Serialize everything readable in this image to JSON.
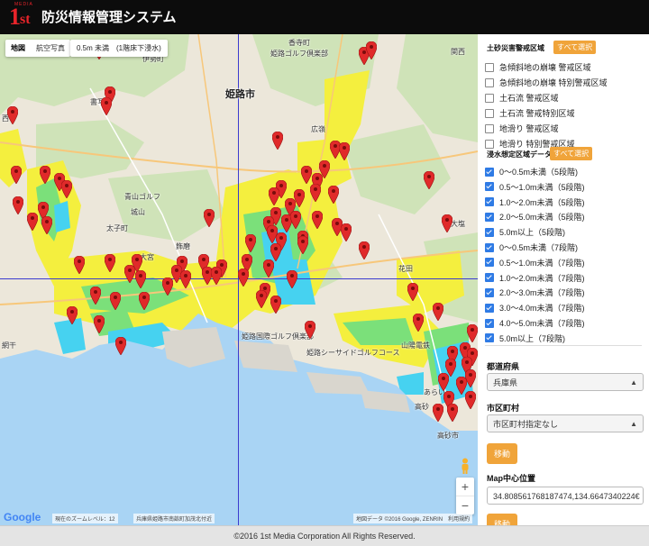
{
  "header": {
    "logo_main": "1",
    "logo_sub": "st",
    "logo_small": "MEDIA",
    "title": "防災情報管理システム"
  },
  "map": {
    "type_tabs": [
      "地図",
      "航空写真"
    ],
    "legend_label": "0.5m 未満　(1階床下浸水)",
    "zoom_in": "+",
    "zoom_out": "−",
    "google_logo": "Google",
    "zoom_info": "現在のズームレベル：12",
    "coord_info": "兵庫県姫路市南畝町加茂北付近",
    "attribution": "地図データ ©2016 Google, ZENRIN　利用規約",
    "labels": {
      "himeji": "姫路市",
      "kohmachi": "香寺町",
      "ichikawa": "伊勢町",
      "kouenji": "書写",
      "himeji_golf": "姫路ゴルフ倶楽部",
      "kokusai": "姫路国際ゴルフ倶楽部",
      "hiroshi": "広嶺",
      "hanada": "花田",
      "shikama": "飾磨",
      "aboshi": "網干",
      "taishi": "太子町",
      "kojo": "城山",
      "aoyama": "青山ゴルフ",
      "kodai": "大塩",
      "omiya": "大宮",
      "sansen": "山陽電鉄",
      "seaside": "姫路シーサイドゴルフコース",
      "takasago": "高砂",
      "takasago_bio": "高砂市",
      "arai": "あらい",
      "kansai": "関西",
      "nishi": "西"
    }
  },
  "sidebar": {
    "landslide_title": "土砂災害警戒区域",
    "select_all_1": "すべて選択",
    "landslide_items": [
      {
        "label": "急傾斜地の崩壊 警戒区域",
        "checked": false
      },
      {
        "label": "急傾斜地の崩壊 特別警戒区域",
        "checked": false
      },
      {
        "label": "土石流 警戒区域",
        "checked": false
      },
      {
        "label": "土石流 警戒特別区域",
        "checked": false
      },
      {
        "label": "地滑り 警戒区域",
        "checked": false
      },
      {
        "label": "地滑り 特別警戒区域",
        "checked": false
      }
    ],
    "flood_title": "浸水想定区域データ",
    "select_all_2": "すべて選択",
    "flood_items": [
      {
        "label": "0〜0.5m未満（5段階)",
        "checked": true
      },
      {
        "label": "0.5〜1.0m未満（5段階)",
        "checked": true
      },
      {
        "label": "1.0〜2.0m未満（5段階)",
        "checked": true
      },
      {
        "label": "2.0〜5.0m未満（5段階)",
        "checked": true
      },
      {
        "label": "5.0m以上（5段階)",
        "checked": true
      },
      {
        "label": "0〜0.5m未満（7段階)",
        "checked": true
      },
      {
        "label": "0.5〜1.0m未満（7段階)",
        "checked": true
      },
      {
        "label": "1.0〜2.0m未満（7段階)",
        "checked": true
      },
      {
        "label": "2.0〜3.0m未満（7段階)",
        "checked": true
      },
      {
        "label": "3.0〜4.0m未満（7段階)",
        "checked": true
      },
      {
        "label": "4.0〜5.0m未満（7段階)",
        "checked": true
      },
      {
        "label": "5.0m以上（7段階)",
        "checked": true
      }
    ],
    "pref_label": "都道府県",
    "pref_value": "兵庫県",
    "city_label": "市区町村",
    "city_value": "市区町村指定なし",
    "move_button": "移動",
    "center_label": "Map中心位置",
    "center_value": "34.808561768187474,134.6647340224€",
    "move_button2": "移動"
  },
  "footer": {
    "copyright": "©2016 1st Media Corporation All Rights Reserved."
  },
  "colors": {
    "accent": "#f0a43a",
    "pin": "#e02a2a",
    "crosshair": "#3b3bcf",
    "flood_yellow": "#f4ef3e",
    "flood_green": "#7be07a",
    "flood_cyan": "#46d2f0",
    "sea": "#a9d4f4"
  }
}
